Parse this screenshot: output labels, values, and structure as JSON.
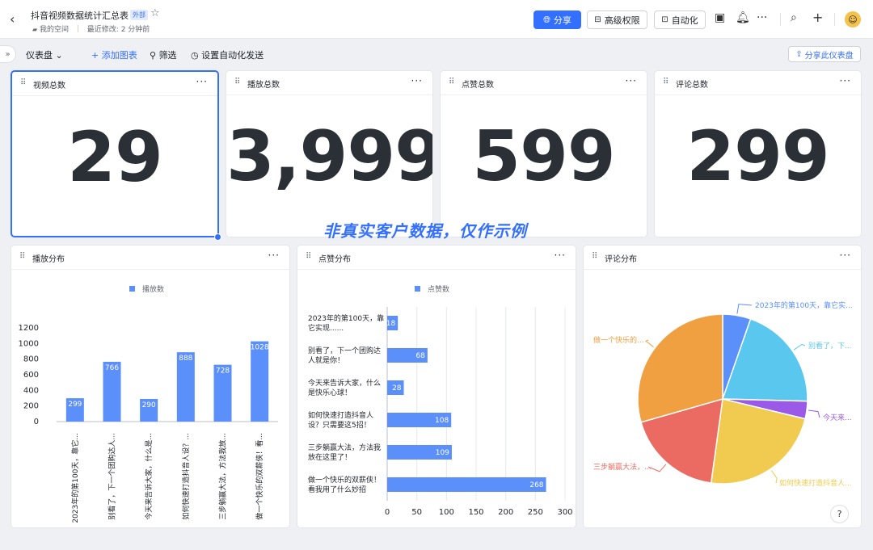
{
  "header": {
    "title": "抖音视频数据统计汇总表",
    "tag": "外部",
    "space": "我的空间",
    "modified": "最近修改: 2 分钟前",
    "share_label": "分享",
    "permission_label": "高级权限",
    "automation_label": "自动化"
  },
  "toolbar": {
    "dashboard_label": "仪表盘",
    "add_chart_label": "添加图表",
    "filter_label": "筛选",
    "auto_send_label": "设置自动化发送",
    "share_dashboard_label": "分享此仪表盘"
  },
  "metrics": [
    {
      "title": "视频总数",
      "value": "29"
    },
    {
      "title": "播放总数",
      "value": "3,999"
    },
    {
      "title": "点赞总数",
      "value": "599"
    },
    {
      "title": "评论总数",
      "value": "299"
    }
  ],
  "watermark": "非真实客户数据，仅作示例",
  "charts": {
    "play": {
      "title": "播放分布"
    },
    "like": {
      "title": "点赞分布"
    },
    "comment": {
      "title": "评论分布"
    }
  },
  "colors": {
    "accent": "#3370ff",
    "bar": "#5b8ff9"
  },
  "chart_data": [
    {
      "type": "bar",
      "title": "播放分布",
      "legend": "播放数",
      "categories": [
        "2023年的第100天，靠它...",
        "别看了，下一个团购达人...",
        "今天来告诉大家，什么是...",
        "如何快速打造抖音人设？...",
        "三步躺赢大法，方法我放...",
        "做一个快乐的双薪侠！看..."
      ],
      "values": [
        299,
        766,
        290,
        888,
        728,
        1028
      ],
      "ylim": [
        0,
        1200
      ],
      "yticks": [
        0,
        200,
        400,
        600,
        800,
        1000,
        1200
      ]
    },
    {
      "type": "bar",
      "orientation": "horizontal",
      "title": "点赞分布",
      "legend": "点赞数",
      "categories": [
        [
          "2023年的第100天，靠",
          "它实现......"
        ],
        [
          "别看了，下一个团购达",
          "人就是你！"
        ],
        [
          "今天来告诉大家，什么",
          "是快乐心球！"
        ],
        [
          "如何快速打造抖音人",
          "设？只需要这5招！"
        ],
        [
          "三步躺赢大法，方法我",
          "放在这里了！"
        ],
        [
          "做一个快乐的双薪侠！",
          "看我用了什么妙招"
        ]
      ],
      "values": [
        18,
        68,
        28,
        108,
        109,
        268
      ],
      "xlim": [
        0,
        300
      ],
      "xticks": [
        0,
        50,
        100,
        150,
        200,
        250,
        300
      ]
    },
    {
      "type": "pie",
      "title": "评论分布",
      "labels": [
        "2023年的第100天，靠它实...",
        "别看了，下...",
        "今天来...",
        "如何快速打造抖音人...",
        "三步躺赢大法，...",
        "做一个快乐的..."
      ],
      "values": [
        16,
        60,
        10,
        70,
        55,
        88
      ],
      "colors": [
        "#5b8ff9",
        "#5ac8ee",
        "#9b59e8",
        "#f0cb4f",
        "#eb6b63",
        "#f0a040"
      ]
    }
  ]
}
